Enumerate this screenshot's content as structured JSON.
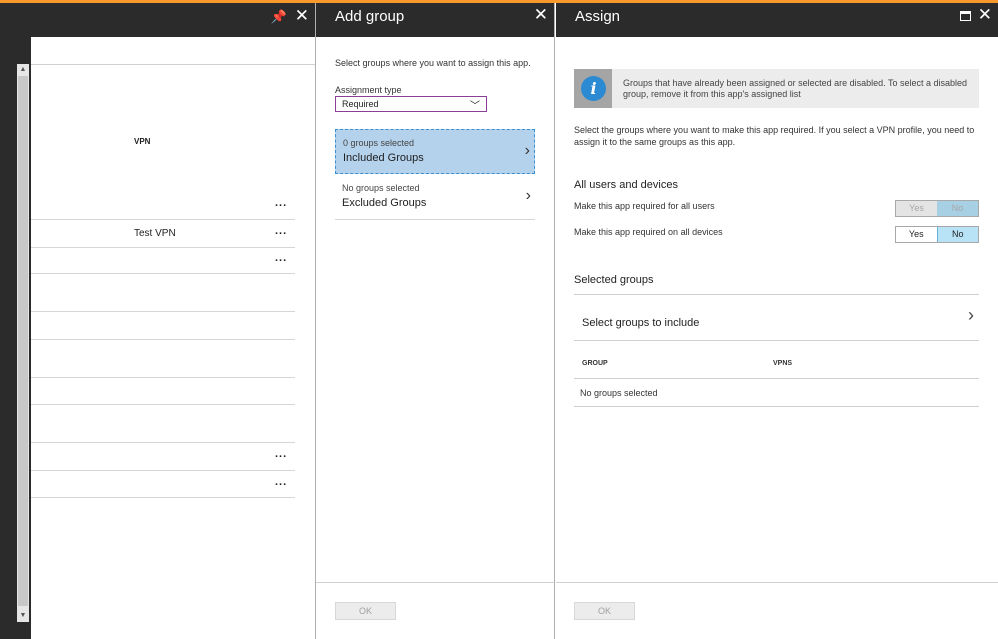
{
  "add_group": {
    "title": "Add group",
    "description": "Select groups where you want to assign this app.",
    "assignment_type_label": "Assignment type",
    "assignment_type_value": "Required",
    "included": {
      "count_text": "0 groups selected",
      "label": "Included Groups"
    },
    "excluded": {
      "count_text": "No groups selected",
      "label": "Excluded Groups"
    },
    "ok_label": "OK"
  },
  "left_blade": {
    "column_header": "VPN",
    "rows": [
      {
        "vpn": "",
        "more": "..."
      },
      {
        "vpn": "Test VPN",
        "more": "..."
      },
      {
        "vpn": "",
        "more": "..."
      },
      {
        "vpn": "",
        "more": ""
      },
      {
        "vpn": "",
        "more": ""
      },
      {
        "vpn": "",
        "more": ""
      },
      {
        "vpn": "",
        "more": ""
      },
      {
        "vpn": "",
        "more": ""
      },
      {
        "vpn": "",
        "more": "..."
      },
      {
        "vpn": "",
        "more": "..."
      }
    ]
  },
  "assign": {
    "title": "Assign",
    "info_text": "Groups that have already been assigned or selected are disabled. To select a disabled group, remove it from this app's assigned list",
    "description": "Select the groups where you want to make this app required. If you select a VPN profile, you need to assign it to the same groups as this app.",
    "all_users_section": "All users and devices",
    "all_users_label": "Make this app required for all users",
    "all_devices_label": "Make this app required on all devices",
    "yes_label": "Yes",
    "no_label": "No",
    "all_users_value": "No",
    "all_devices_value": "No",
    "selected_groups_section": "Selected groups",
    "select_groups_label": "Select groups to include",
    "table": {
      "col_group": "GROUP",
      "col_vpns": "VPNS",
      "empty_text": "No groups selected"
    },
    "ok_label": "OK"
  },
  "colors": {
    "accent": "#f79a2b",
    "header_bg": "#2b2b2b",
    "selected_item_bg": "#b4d2ec",
    "info_icon": "#2b8ad1",
    "select_border": "#8a3f97"
  }
}
